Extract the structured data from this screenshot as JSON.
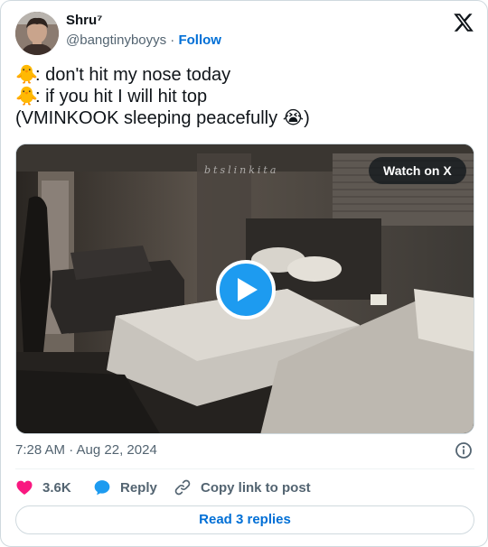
{
  "author": {
    "display_name": "Shru⁷",
    "handle": "@bangtinyboyys",
    "separator": "·",
    "follow_label": "Follow"
  },
  "tweet": {
    "lines": [
      {
        "emoji": "🐥",
        "text": ": don't hit my nose today"
      },
      {
        "emoji": "🐥",
        "text": ": if you hit I will hit top"
      },
      {
        "text": "(VMINKOOK sleeping peacefully ",
        "emoji_end": "😭",
        "close": ")"
      }
    ]
  },
  "media": {
    "watermark": "btslinkita",
    "watch_label": "Watch on X"
  },
  "timestamp": "7:28 AM · Aug 22, 2024",
  "actions": {
    "likes": "3.6K",
    "reply_label": "Reply",
    "copy_label": "Copy link to post"
  },
  "read_replies_label": "Read 3 replies",
  "colors": {
    "accent": "#1d9bf0",
    "link": "#006fd6",
    "heart": "#f91880",
    "secondary_text": "#536471"
  }
}
